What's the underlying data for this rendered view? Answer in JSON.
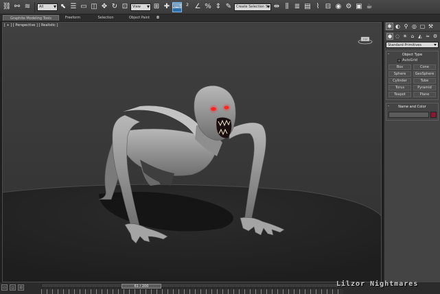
{
  "toolbar": {
    "filter_value": "All",
    "coord_system": "View",
    "named_selection": "Create Selection Se"
  },
  "ribbon": {
    "tabs": [
      "Graphite Modeling Tools",
      "Freeform",
      "Selection",
      "Object Paint"
    ]
  },
  "viewport": {
    "label": "[ + ] [ Perspective ] [ Realistic ]",
    "viewcube_label": "TOP"
  },
  "command_panel": {
    "category_dropdown": "Standard Primitives",
    "object_type": {
      "header": "Object Type",
      "autogrid_label": "AutoGrid",
      "primitives": [
        "Box",
        "Cone",
        "Sphere",
        "GeoSphere",
        "Cylinder",
        "Tube",
        "Torus",
        "Pyramid",
        "Teapot",
        "Plane"
      ]
    },
    "name_color": {
      "header": "Name and Color",
      "swatch_color": "#8a1830"
    }
  },
  "timeline": {
    "frame_display": "61 / 200",
    "frame_progress": 0.305
  },
  "watermark": "Lilzor Nightmares"
}
